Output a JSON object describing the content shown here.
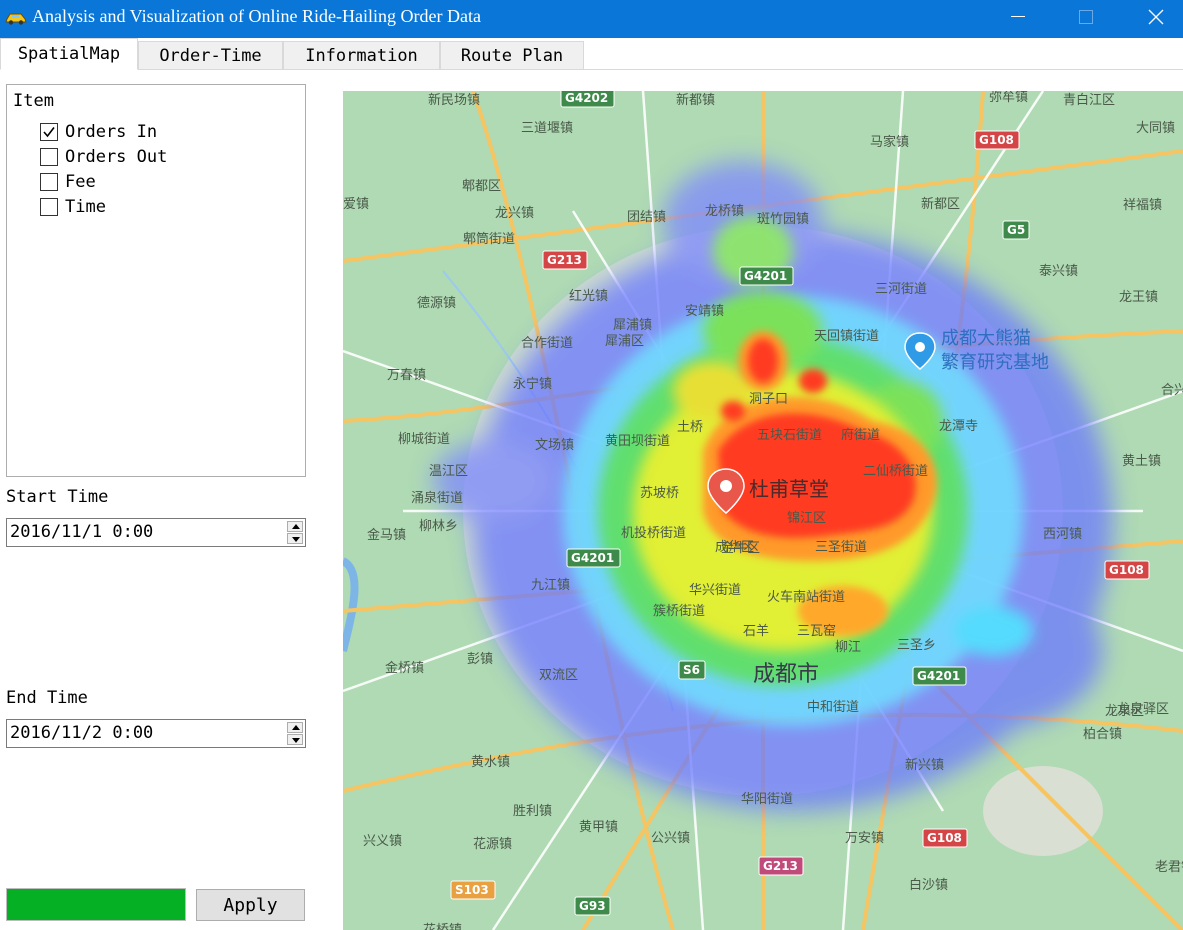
{
  "window": {
    "title": "Analysis and Visualization of Online Ride-Hailing Order Data",
    "icon": "taxi-icon"
  },
  "tabs": [
    {
      "label": "SpatialMap",
      "active": true
    },
    {
      "label": "Order-Time",
      "active": false
    },
    {
      "label": "Information",
      "active": false
    },
    {
      "label": "Route Plan",
      "active": false
    }
  ],
  "item_group": {
    "title": "Item",
    "options": [
      {
        "label": "Orders In",
        "checked": true
      },
      {
        "label": "Orders Out",
        "checked": false
      },
      {
        "label": "Fee",
        "checked": false
      },
      {
        "label": "Time",
        "checked": false
      }
    ]
  },
  "start_time": {
    "label": "Start Time",
    "value": "2016/11/1 0:00"
  },
  "end_time": {
    "label": "End Time",
    "value": "2016/11/2 0:00"
  },
  "progress": {
    "value_percent": 100,
    "color": "#06b025"
  },
  "apply_label": "Apply",
  "map": {
    "main_labels": {
      "city": "成都市",
      "poi_center": "杜甫草堂",
      "poi_panda_line1": "成都大熊猫",
      "poi_panda_line2": "繁育研究基地",
      "river": "岷江"
    },
    "places": [
      "新民场镇",
      "新都镇",
      "弥牟镇",
      "青白江区",
      "大同镇",
      "三道堰镇",
      "马家镇",
      "郫都区",
      "龙桥镇",
      "新都区",
      "祥福镇",
      "爱镇",
      "龙兴镇",
      "团结镇",
      "斑竹园镇",
      "郫筒街道",
      "泰兴镇",
      "红光镇",
      "三河街道",
      "龙王镇",
      "德源镇",
      "安靖镇",
      "合作街道",
      "犀浦镇",
      "天回镇街道",
      "犀浦区",
      "万春镇",
      "永宁镇",
      "合兴镇",
      "洞子口",
      "柳城街道",
      "文场镇",
      "黄田坝街道",
      "土桥",
      "五块石街道",
      "府街道",
      "龙潭寺",
      "黄土镇",
      "温江区",
      "苏坡桥",
      "二仙桥街道",
      "涌泉街道",
      "金马镇",
      "柳林乡",
      "机投桥街道",
      "金牛区",
      "锦江区",
      "西河镇",
      "九江镇",
      "成华区",
      "三圣街道",
      "华兴街道",
      "火车南站街道",
      "金桥镇",
      "彭镇",
      "簇桥街道",
      "石羊",
      "三瓦窑",
      "柳江",
      "三圣乡",
      "双流区",
      "中和街道",
      "龙泉驿区",
      "柏合镇",
      "黄水镇",
      "新兴镇",
      "胜利镇",
      "华阳街道",
      "兴义镇",
      "花源镇",
      "黄甲镇",
      "公兴镇",
      "万安镇",
      "老君镇",
      "白沙镇",
      "花桥镇",
      "龙泉区"
    ],
    "highways": [
      "G4202",
      "G108",
      "G5",
      "G213",
      "G4201",
      "G4201",
      "G4201",
      "S6",
      "G108",
      "G108",
      "G213",
      "G93",
      "S103"
    ]
  }
}
